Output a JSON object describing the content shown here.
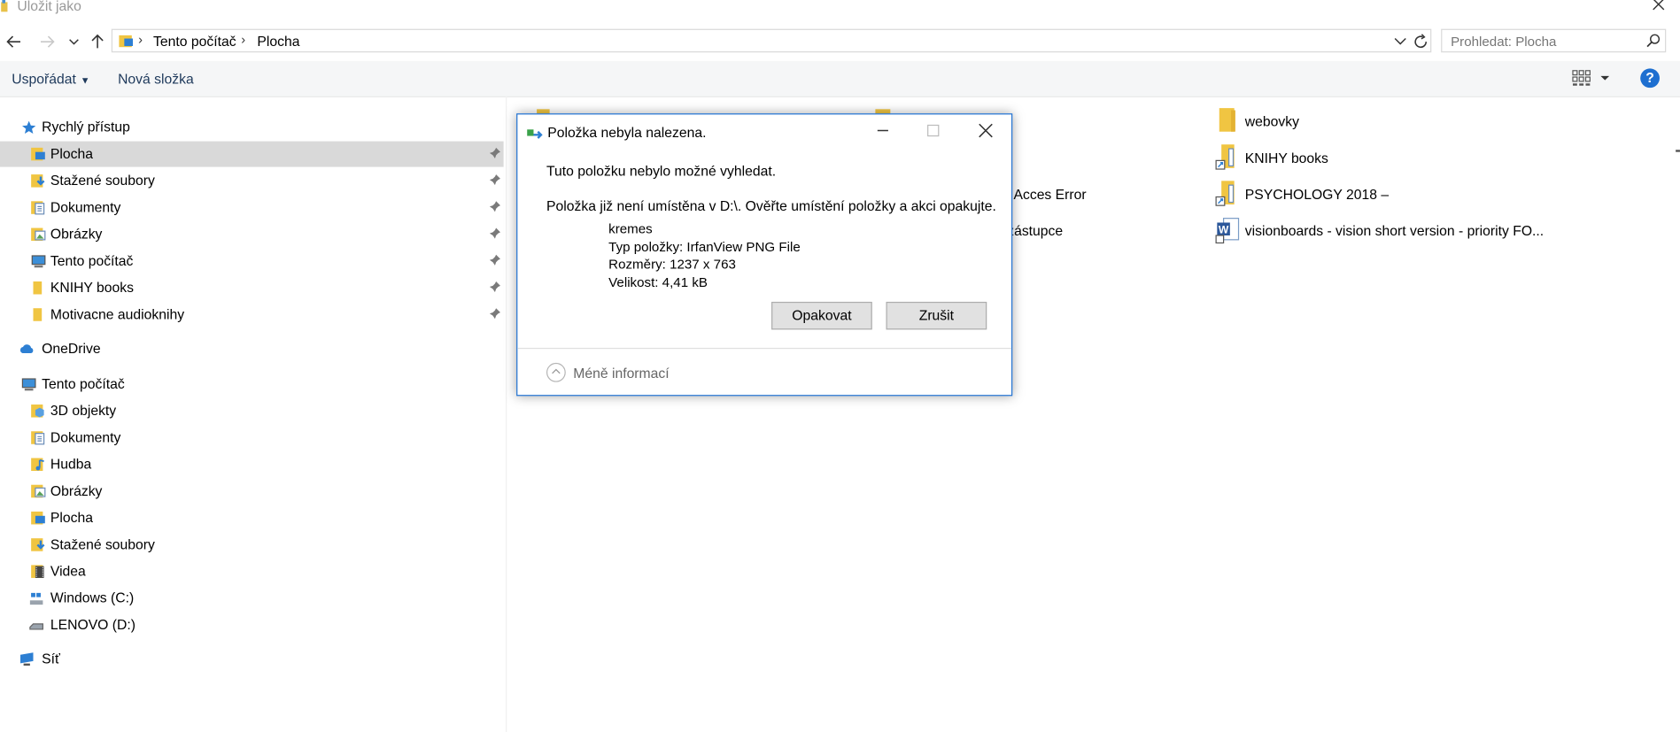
{
  "window": {
    "title": "Uložit jako"
  },
  "address": {
    "crumbs": [
      "Tento počítač",
      "Plocha"
    ],
    "search_placeholder": "Prohledat: Plocha"
  },
  "toolbar": {
    "organize": "Uspořádat",
    "new_folder": "Nová složka",
    "help": "?"
  },
  "sidebar": {
    "quick_access": "Rychlý přístup",
    "quick_items": [
      "Plocha",
      "Stažené soubory",
      "Dokumenty",
      "Obrázky",
      "Tento počítač",
      "KNIHY books",
      "Motivacne audioknihy"
    ],
    "onedrive": "OneDrive",
    "this_pc": "Tento počítač",
    "pc_items": [
      "3D objekty",
      "Dokumenty",
      "Hudba",
      "Obrázky",
      "Plocha",
      "Stažené soubory",
      "Videa",
      "Windows (C:)",
      "LENOVO (D:)"
    ],
    "network": "Síť"
  },
  "files": {
    "partial_1": "Acces Error",
    "partial_2": "zástupce",
    "right_column": [
      "webovky",
      "KNIHY books",
      "PSYCHOLOGY 2018 –",
      "visionboards  - vision short version - priority FO..."
    ]
  },
  "dialog": {
    "title": "Položka nebyla nalezena.",
    "message1": "Tuto položku nebylo možné vyhledat.",
    "message2": "Položka již není umístěna v D:\\. Ověřte umístění položky a akci opakujte.",
    "name": "kremes",
    "type": "Typ položky: IrfanView PNG File",
    "dimensions": "Rozměry: 1237 x 763",
    "size": "Velikost: 4,41 kB",
    "retry": "Opakovat",
    "cancel": "Zrušit",
    "less_info": "Méně informací"
  }
}
